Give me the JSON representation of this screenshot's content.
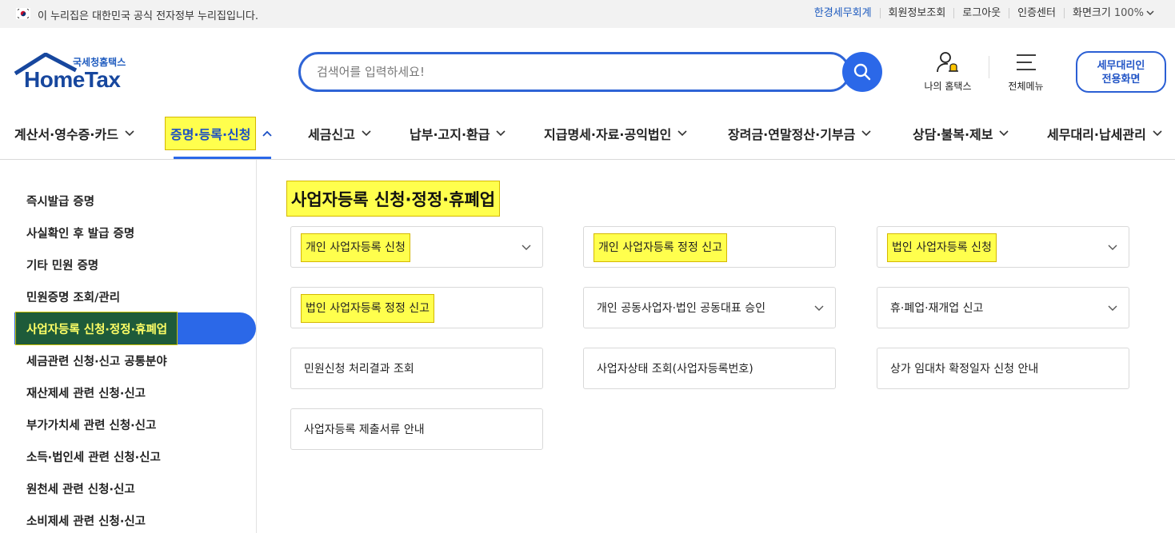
{
  "gov_bar": {
    "notice": "이 누리집은 대한민국 공식 전자정부 누리집입니다.",
    "links": [
      "한경세무회계",
      "회원정보조회",
      "로그아웃",
      "인증센터"
    ],
    "zoom_label": "화면크기",
    "zoom_value": "100%"
  },
  "logo": {
    "sub": "국세청홈택스",
    "main": "HomeTax"
  },
  "search": {
    "placeholder": "검색어를 입력하세요!",
    "value": ""
  },
  "header": {
    "my_hometax": "나의 홈택스",
    "all_menu": "전체메뉴",
    "agent_line1": "세무대리인",
    "agent_line2": "전용화면"
  },
  "gnb": [
    {
      "label": "계산서·영수증·카드"
    },
    {
      "label": "증명·등록·신청",
      "active": true
    },
    {
      "label": "세금신고"
    },
    {
      "label": "납부·고지·환급"
    },
    {
      "label": "지급명세·자료·공익법인"
    },
    {
      "label": "장려금·연말정산·기부금"
    },
    {
      "label": "상담·불복·제보"
    },
    {
      "label": "세무대리·납세관리"
    }
  ],
  "side_nav": [
    "즉시발급 증명",
    "사실확인 후 발급 증명",
    "기타 민원 증명",
    "민원증명 조회/관리",
    "사업자등록 신청·정정·휴폐업",
    "세금관련 신청·신고 공통분야",
    "재산제세 관련 신청·신고",
    "부가가치세 관련 신청·신고",
    "소득·법인세 관련 신청·신고",
    "원천세 관련 신청·신고",
    "소비제세 관련 신청·신고"
  ],
  "side_active_index": 4,
  "page_title": "사업자등록 신청·정정·휴폐업",
  "cards": [
    "개인 사업자등록 신청",
    "개인 사업자등록 정정 신고",
    "법인 사업자등록 신청",
    "법인 사업자등록 정정 신고",
    "개인 공동사업자·법인 공동대표 승인",
    "휴·폐업·재개업 신고",
    "민원신청 처리결과 조회",
    "사업자상태 조회(사업자등록번호)",
    "상가 임대차 확정일자 신청 안내",
    "사업자등록 제출서류 안내"
  ],
  "colors": {
    "accent": "#2b68e8",
    "highlight": "#ffff4d",
    "brand": "#17479e"
  }
}
